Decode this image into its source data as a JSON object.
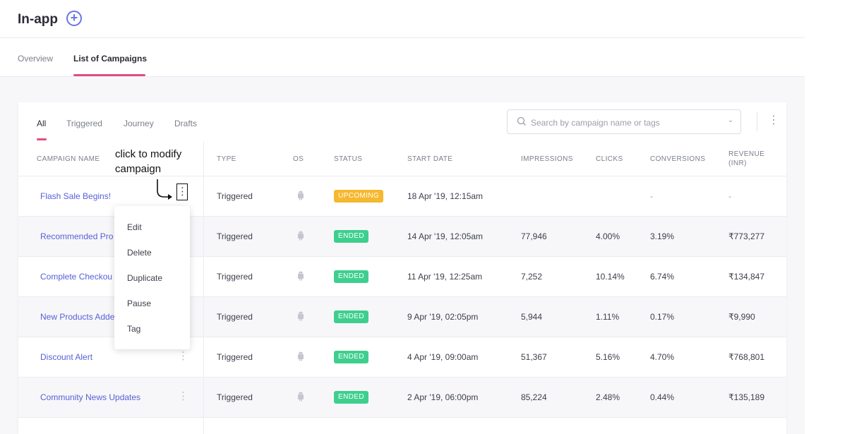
{
  "header": {
    "title": "In-app",
    "add_icon": "plus-circle-icon"
  },
  "subnav": {
    "tabs": [
      "Overview",
      "List of Campaigns"
    ],
    "active": "List of Campaigns"
  },
  "filters": {
    "tabs": [
      "All",
      "Triggered",
      "Journey",
      "Drafts"
    ],
    "active": "All"
  },
  "search": {
    "placeholder": "Search by campaign name or tags"
  },
  "annotation": {
    "line1": "click to modify",
    "line2": "campaign"
  },
  "table": {
    "headers": {
      "name": "CAMPAIGN NAME",
      "type": "TYPE",
      "os": "OS",
      "status": "STATUS",
      "start": "START DATE",
      "impressions": "IMPRESSIONS",
      "clicks": "CLICKS",
      "conversions": "CONVERSIONS",
      "revenue1": "REVENUE",
      "revenue2": "(INR)"
    },
    "rows": [
      {
        "name": "Flash Sale Begins!",
        "type": "Triggered",
        "status": "UPCOMING",
        "start": "18 Apr '19, 12:15am",
        "impressions": "",
        "clicks": "",
        "conversions": "-",
        "revenue": "-"
      },
      {
        "name": "Recommended Pro",
        "type": "Triggered",
        "status": "ENDED",
        "start": "14 Apr '19, 12:05am",
        "impressions": "77,946",
        "clicks": "4.00%",
        "conversions": "3.19%",
        "revenue": "₹773,277"
      },
      {
        "name": "Complete Checkou",
        "type": "Triggered",
        "status": "ENDED",
        "start": "11 Apr '19, 12:25am",
        "impressions": "7,252",
        "clicks": "10.14%",
        "conversions": "6.74%",
        "revenue": "₹134,847"
      },
      {
        "name": "New Products Adde",
        "type": "Triggered",
        "status": "ENDED",
        "start": "9 Apr '19, 02:05pm",
        "impressions": "5,944",
        "clicks": "1.11%",
        "conversions": "0.17%",
        "revenue": "₹9,990"
      },
      {
        "name": "Discount Alert",
        "type": "Triggered",
        "status": "ENDED",
        "start": "4 Apr '19, 09:00am",
        "impressions": "51,367",
        "clicks": "5.16%",
        "conversions": "4.70%",
        "revenue": "₹768,801"
      },
      {
        "name": "Community News Updates",
        "type": "Triggered",
        "status": "ENDED",
        "start": "2 Apr '19, 06:00pm",
        "impressions": "85,224",
        "clicks": "2.48%",
        "conversions": "0.44%",
        "revenue": "₹135,189"
      }
    ]
  },
  "menu": {
    "items": [
      "Edit",
      "Delete",
      "Duplicate",
      "Pause",
      "Tag"
    ]
  },
  "colors": {
    "accent": "#e44b86",
    "link": "#5860d8",
    "upcoming": "#f5b82e",
    "ended": "#3ecf8e",
    "brand": "#6b74e6"
  }
}
